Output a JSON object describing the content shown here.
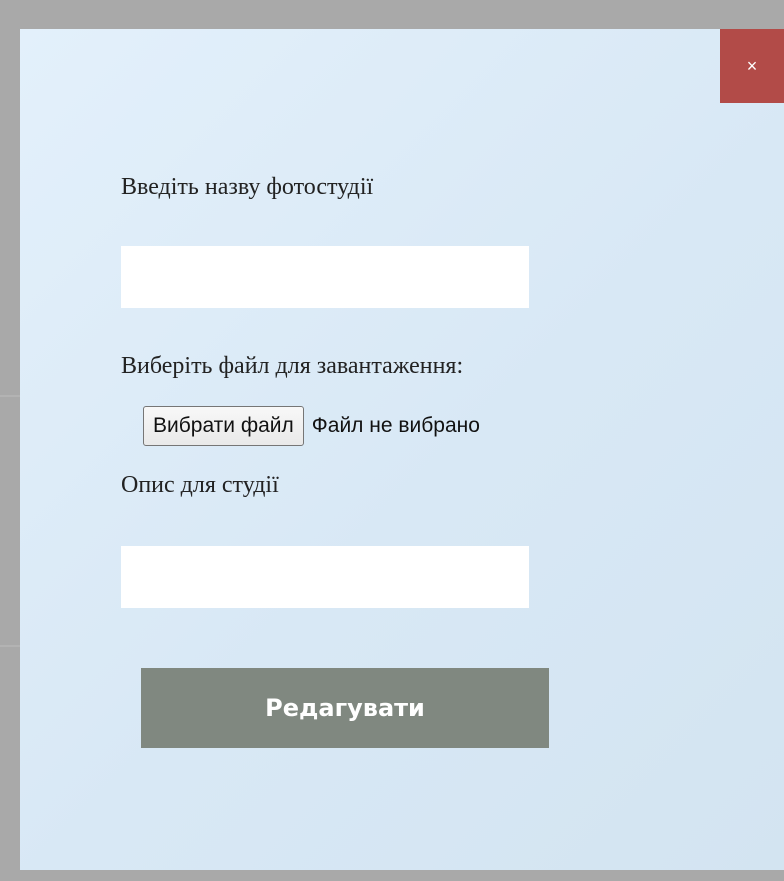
{
  "modal": {
    "close_label": "×",
    "name_label": "Введіть назву фотостудії",
    "name_value": "",
    "file_label": "Виберіть файл для завантаження:",
    "file_button_label": "Вибрати файл",
    "file_status": "Файл не вибрано",
    "description_label": "Опис для студії",
    "description_value": "",
    "submit_label": "Редагувати"
  },
  "colors": {
    "close_button": "#b24b48",
    "submit_button": "#808880",
    "modal_background": "#dbeaf6",
    "overlay": "#a9a9a9"
  },
  "icons": {
    "close": "close-icon"
  }
}
